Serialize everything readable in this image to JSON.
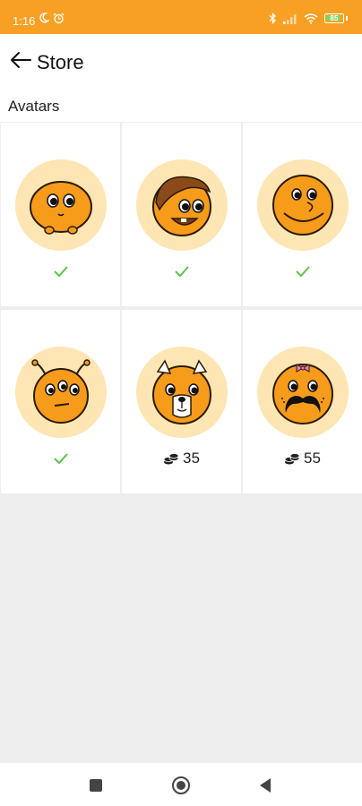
{
  "status_bar": {
    "time": "1:16",
    "battery_level": "85"
  },
  "header": {
    "title": "Store"
  },
  "section": {
    "label": "Avatars"
  },
  "avatars": [
    {
      "icon": "orange-blob-avatar",
      "owned": true,
      "price": ""
    },
    {
      "icon": "brown-hair-avatar",
      "owned": true,
      "price": ""
    },
    {
      "icon": "smiling-avatar",
      "owned": true,
      "price": ""
    },
    {
      "icon": "alien-avatar",
      "owned": true,
      "price": ""
    },
    {
      "icon": "bear-avatar",
      "owned": false,
      "price": "35"
    },
    {
      "icon": "mustache-avatar",
      "owned": false,
      "price": "55"
    }
  ],
  "colors": {
    "accent": "#f7a024",
    "check": "#5fc14a",
    "avatar_bg": "#fde6b3",
    "face": "#f79b1b"
  }
}
